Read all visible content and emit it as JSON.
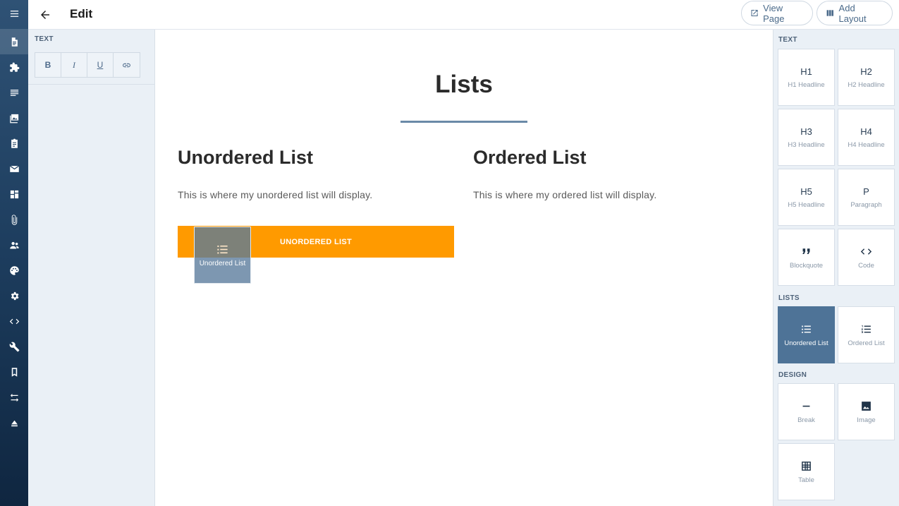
{
  "header": {
    "title": "Edit",
    "view_page_label": "View Page",
    "add_layout_label": "Add Layout"
  },
  "rail": {
    "icons": [
      "menu-icon",
      "document-icon",
      "puzzle-icon",
      "lines-icon",
      "images-icon",
      "clipboard-icon",
      "mail-icon",
      "dashboard-icon",
      "paperclip-icon",
      "people-icon",
      "palette-icon",
      "gear-icon",
      "code-icon",
      "wrench-icon",
      "bookmark-icon",
      "swap-icon",
      "eject-icon"
    ],
    "active": "document-icon"
  },
  "toolpanel": {
    "section": "TEXT",
    "buttons": [
      "B",
      "I",
      "U"
    ],
    "link_icon": "link-icon"
  },
  "canvas": {
    "title": "Lists",
    "left": {
      "heading": "Unordered List",
      "text": "This is where my unordered list will display."
    },
    "right": {
      "heading": "Ordered List",
      "text": "This is where my ordered list will display."
    },
    "drop_zone_label": "UNORDERED LIST",
    "drag_ghost_label": "Unordered List",
    "drop_zone_color": "#ff9a00"
  },
  "components": {
    "text_section": "TEXT",
    "lists_section": "LISTS",
    "design_section": "DESIGN",
    "tiles": {
      "h1": {
        "glyph": "H1",
        "caption": "H1 Headline"
      },
      "h2": {
        "glyph": "H2",
        "caption": "H2 Headline"
      },
      "h3": {
        "glyph": "H3",
        "caption": "H3 Headline"
      },
      "h4": {
        "glyph": "H4",
        "caption": "H4 Headline"
      },
      "h5": {
        "glyph": "H5",
        "caption": "H5 Headline"
      },
      "paragraph": {
        "glyph": "P",
        "caption": "Paragraph"
      },
      "blockquote": {
        "caption": "Blockquote"
      },
      "code": {
        "caption": "Code"
      },
      "unordered": {
        "caption": "Unordered List"
      },
      "ordered": {
        "caption": "Ordered List"
      },
      "break": {
        "caption": "Break"
      },
      "image": {
        "caption": "Image"
      },
      "table": {
        "caption": "Table"
      }
    },
    "selected": "unordered",
    "accent": "#4e7397"
  }
}
